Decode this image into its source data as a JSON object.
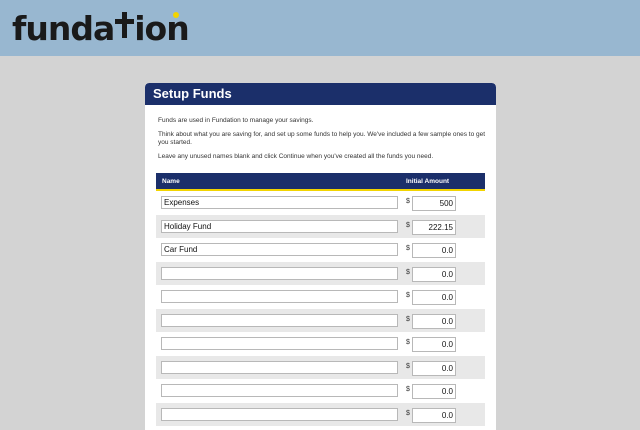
{
  "brand": {
    "logo_text_a": "funda",
    "logo_text_b": "ion"
  },
  "panel": {
    "title": "Setup Funds",
    "intro": [
      "Funds are used in Fundation to manage your savings.",
      "Think about what you are saving for, and set up some funds to help you. We've included a few sample ones to get you started.",
      "Leave any unused names blank and click Continue when you've created all the funds you need."
    ]
  },
  "table": {
    "headers": {
      "name": "Name",
      "amount": "Initial Amount"
    },
    "currency": "$",
    "rows": [
      {
        "name": "Expenses",
        "amount": "500"
      },
      {
        "name": "Holiday Fund",
        "amount": "222.15"
      },
      {
        "name": "Car Fund",
        "amount": "0.0"
      },
      {
        "name": "",
        "amount": "0.0"
      },
      {
        "name": "",
        "amount": "0.0"
      },
      {
        "name": "",
        "amount": "0.0"
      },
      {
        "name": "",
        "amount": "0.0"
      },
      {
        "name": "",
        "amount": "0.0"
      },
      {
        "name": "",
        "amount": "0.0"
      },
      {
        "name": "",
        "amount": "0.0"
      }
    ]
  },
  "colors": {
    "header_bg": "#98b7d0",
    "panel_title_bg": "#1b2f6a",
    "accent": "#f2d400"
  }
}
